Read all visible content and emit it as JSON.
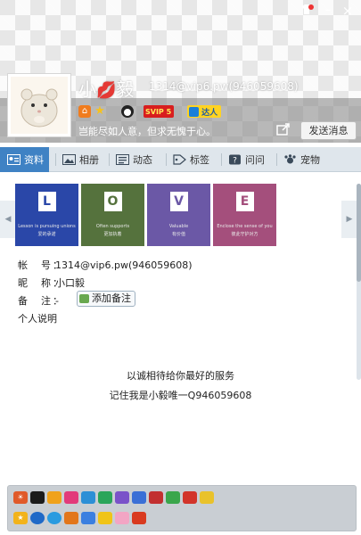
{
  "header": {
    "nickname_prefix": "小",
    "nickname_suffix": "毅",
    "account_display": "1314@vip6.pw(946059608)",
    "signature": "岂能尽如人意，但求无愧于心。",
    "send_message_label": "发送消息",
    "svip_label": "SVIP 5",
    "daren_label": "达人"
  },
  "tabs": [
    {
      "label": "资料",
      "icon": "profile-card-icon",
      "active": true
    },
    {
      "label": "相册",
      "icon": "photo-album-icon",
      "active": false
    },
    {
      "label": "动态",
      "icon": "feed-icon",
      "active": false
    },
    {
      "label": "标签",
      "icon": "tag-icon",
      "active": false
    },
    {
      "label": "问问",
      "icon": "question-icon",
      "active": false
    },
    {
      "label": "宠物",
      "icon": "pet-icon",
      "active": false
    }
  ],
  "photos": [
    {
      "letter": "L",
      "caption1": "Lesson is pursuing unions",
      "caption2": "爱的承诺"
    },
    {
      "letter": "O",
      "caption1": "Often supports",
      "caption2": "更加执着"
    },
    {
      "letter": "V",
      "caption1": "Valuable",
      "caption2": "有价值"
    },
    {
      "letter": "E",
      "caption1": "Enclose the sense of you",
      "caption2": "彼此守护对方"
    }
  ],
  "info": {
    "account_label": "帐　号：",
    "account_value": "1314@vip6.pw(946059608)",
    "nickname_label": "昵　称：",
    "nickname_value": "小口毅",
    "note_label": "备　注：",
    "note_value": "-",
    "add_note_label": "添加备注",
    "personal_desc_label": "个人说明",
    "desc_line1": "以诚相待给你最好的服务",
    "desc_line2": "记住我是小毅唯一Q946059608"
  },
  "colors": {
    "tab_active": "#3f82c4",
    "tab_bar": "#dfe6ec",
    "photo_l": "#2a47a8",
    "photo_o": "#55723d",
    "photo_v": "#6b58a6",
    "photo_e": "#a44f7c"
  }
}
